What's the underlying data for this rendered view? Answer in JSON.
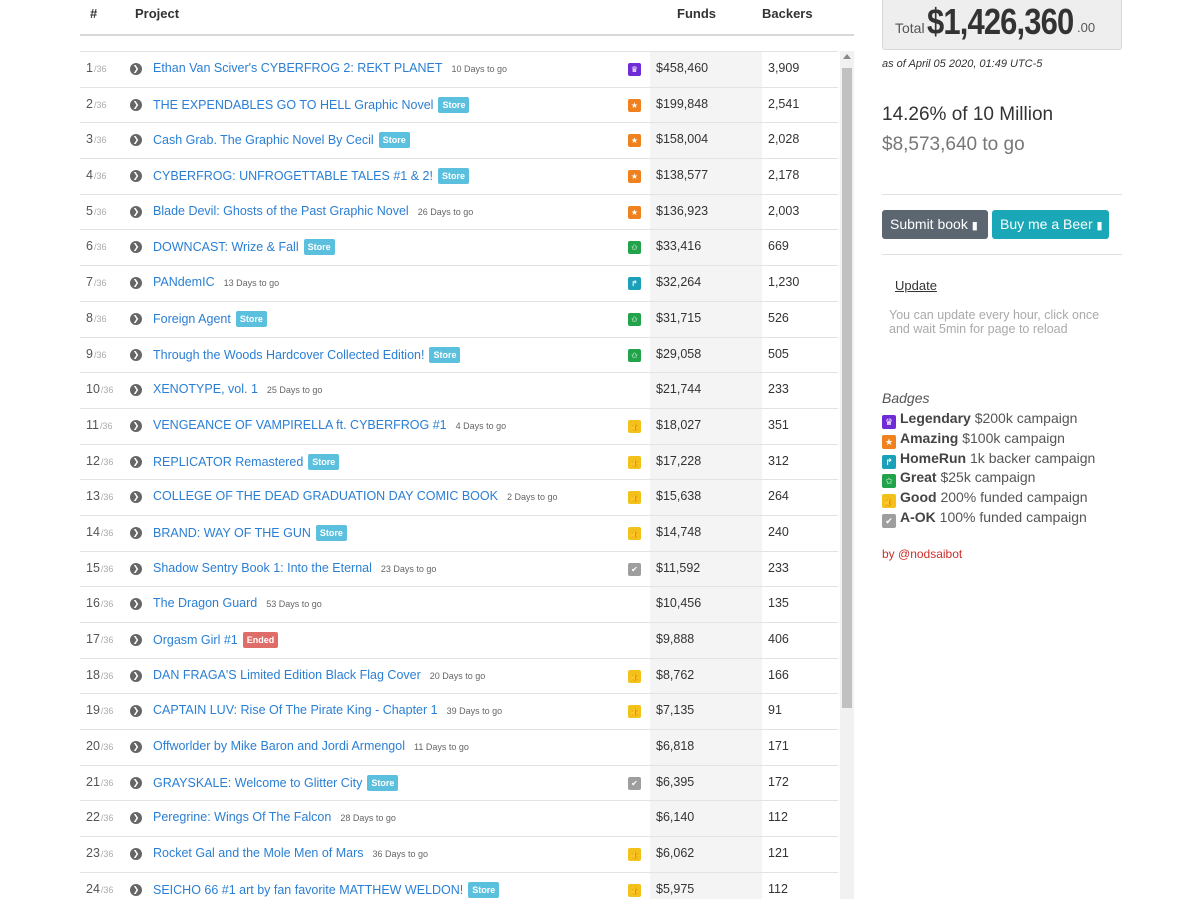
{
  "header": {
    "num": "#",
    "project": "Project",
    "funds": "Funds",
    "backers": "Backers"
  },
  "badge_colors": {
    "legendary": "#6f2bd6",
    "amazing": "#f0811f",
    "homerun": "#1aa0b8",
    "great": "#21a34a",
    "good": "#f2c21b",
    "aok": "#9e9e9e"
  },
  "badge_glyphs": {
    "legendary": "♛",
    "amazing": "★",
    "homerun": "↱",
    "great": "✩",
    "good": "👍",
    "aok": "✔"
  },
  "rows": [
    {
      "rank": "1",
      "of": "/36",
      "title": "Ethan Van Sciver's CYBERFROG 2: REKT PLANET",
      "days": "10 Days to go",
      "store": false,
      "ended": false,
      "badge": "legendary",
      "funds": "$458,460",
      "backers": "3,909"
    },
    {
      "rank": "2",
      "of": "/36",
      "title": "THE EXPENDABLES GO TO HELL Graphic Novel",
      "days": "",
      "store": true,
      "ended": false,
      "badge": "amazing",
      "funds": "$199,848",
      "backers": "2,541"
    },
    {
      "rank": "3",
      "of": "/36",
      "title": "Cash Grab. The Graphic Novel By Cecil",
      "days": "",
      "store": true,
      "ended": false,
      "badge": "amazing",
      "funds": "$158,004",
      "backers": "2,028"
    },
    {
      "rank": "4",
      "of": "/36",
      "title": "CYBERFROG: UNFROGETTABLE TALES #1 & 2!",
      "days": "",
      "store": true,
      "ended": false,
      "badge": "amazing",
      "funds": "$138,577",
      "backers": "2,178"
    },
    {
      "rank": "5",
      "of": "/36",
      "title": "Blade Devil: Ghosts of the Past Graphic Novel",
      "days": "26 Days to go",
      "store": false,
      "ended": false,
      "badge": "amazing",
      "funds": "$136,923",
      "backers": "2,003"
    },
    {
      "rank": "6",
      "of": "/36",
      "title": "DOWNCAST: Wrize & Fall",
      "days": "",
      "store": true,
      "ended": false,
      "badge": "great",
      "funds": "$33,416",
      "backers": "669"
    },
    {
      "rank": "7",
      "of": "/36",
      "title": "PANdemIC",
      "days": "13 Days to go",
      "store": false,
      "ended": false,
      "badge": "homerun",
      "funds": "$32,264",
      "backers": "1,230"
    },
    {
      "rank": "8",
      "of": "/36",
      "title": "Foreign Agent",
      "days": "",
      "store": true,
      "ended": false,
      "badge": "great",
      "funds": "$31,715",
      "backers": "526"
    },
    {
      "rank": "9",
      "of": "/36",
      "title": "Through the Woods Hardcover Collected Edition!",
      "days": "",
      "store": true,
      "ended": false,
      "badge": "great",
      "funds": "$29,058",
      "backers": "505"
    },
    {
      "rank": "10",
      "of": "/36",
      "title": "XENOTYPE, vol. 1",
      "days": "25 Days to go",
      "store": false,
      "ended": false,
      "badge": "",
      "funds": "$21,744",
      "backers": "233"
    },
    {
      "rank": "11",
      "of": "/36",
      "title": "VENGEANCE OF VAMPIRELLA ft. CYBERFROG #1",
      "days": "4 Days to go",
      "store": false,
      "ended": false,
      "badge": "good",
      "funds": "$18,027",
      "backers": "351"
    },
    {
      "rank": "12",
      "of": "/36",
      "title": "REPLICATOR Remastered",
      "days": "",
      "store": true,
      "ended": false,
      "badge": "good",
      "funds": "$17,228",
      "backers": "312"
    },
    {
      "rank": "13",
      "of": "/36",
      "title": "COLLEGE OF THE DEAD GRADUATION DAY COMIC BOOK",
      "days": "2 Days to go",
      "store": false,
      "ended": false,
      "badge": "good",
      "funds": "$15,638",
      "backers": "264"
    },
    {
      "rank": "14",
      "of": "/36",
      "title": "BRAND: WAY OF THE GUN",
      "days": "",
      "store": true,
      "ended": false,
      "badge": "good",
      "funds": "$14,748",
      "backers": "240"
    },
    {
      "rank": "15",
      "of": "/36",
      "title": "Shadow Sentry Book 1: Into the Eternal",
      "days": "23 Days to go",
      "store": false,
      "ended": false,
      "badge": "aok",
      "funds": "$11,592",
      "backers": "233"
    },
    {
      "rank": "16",
      "of": "/36",
      "title": "The Dragon Guard",
      "days": "53 Days to go",
      "store": false,
      "ended": false,
      "badge": "",
      "funds": "$10,456",
      "backers": "135"
    },
    {
      "rank": "17",
      "of": "/36",
      "title": "Orgasm Girl #1",
      "days": "",
      "store": false,
      "ended": true,
      "badge": "",
      "funds": "$9,888",
      "backers": "406"
    },
    {
      "rank": "18",
      "of": "/36",
      "title": "DAN FRAGA'S Limited Edition Black Flag Cover",
      "days": "20 Days to go",
      "store": false,
      "ended": false,
      "badge": "good",
      "funds": "$8,762",
      "backers": "166"
    },
    {
      "rank": "19",
      "of": "/36",
      "title": "CAPTAIN LUV: Rise Of The Pirate King - Chapter 1",
      "days": "39 Days to go",
      "store": false,
      "ended": false,
      "badge": "good",
      "funds": "$7,135",
      "backers": "91"
    },
    {
      "rank": "20",
      "of": "/36",
      "title": "Offworlder by Mike Baron and Jordi Armengol",
      "days": "11 Days to go",
      "store": false,
      "ended": false,
      "badge": "",
      "funds": "$6,818",
      "backers": "171"
    },
    {
      "rank": "21",
      "of": "/36",
      "title": "GRAYSKALE: Welcome to Glitter City",
      "days": "",
      "store": true,
      "ended": false,
      "badge": "aok",
      "funds": "$6,395",
      "backers": "172"
    },
    {
      "rank": "22",
      "of": "/36",
      "title": "Peregrine: Wings Of The Falcon",
      "days": "28 Days to go",
      "store": false,
      "ended": false,
      "badge": "",
      "funds": "$6,140",
      "backers": "112"
    },
    {
      "rank": "23",
      "of": "/36",
      "title": "Rocket Gal and the Mole Men of Mars",
      "days": "36 Days to go",
      "store": false,
      "ended": false,
      "badge": "good",
      "funds": "$6,062",
      "backers": "121"
    },
    {
      "rank": "24",
      "of": "/36",
      "title": "SEICHO 66 #1 art by fan favorite MATTHEW WELDON!",
      "days": "",
      "store": true,
      "ended": false,
      "badge": "good",
      "funds": "$5,975",
      "backers": "112"
    }
  ],
  "labels": {
    "store": "Store",
    "ended": "Ended"
  },
  "total": {
    "label": "Total",
    "amount": "$1,426,360",
    "cents": ".00"
  },
  "as_of": "as of April 05 2020, 01:49 UTC-5",
  "progress": {
    "percent_text": "14.26% of 10 Million",
    "to_go": "$8,573,640 to go"
  },
  "buttons": {
    "submit": "Submit book",
    "beer": "Buy me a Beer"
  },
  "update": {
    "link": "Update",
    "note": "You can update every hour, click once and wait 5min for page to reload"
  },
  "badges_legend": {
    "title": "Badges",
    "items": [
      {
        "key": "legendary",
        "name": "Legendary",
        "desc": "$200k campaign"
      },
      {
        "key": "amazing",
        "name": "Amazing",
        "desc": "$100k campaign"
      },
      {
        "key": "homerun",
        "name": "HomeRun",
        "desc": "1k backer campaign"
      },
      {
        "key": "great",
        "name": "Great",
        "desc": "$25k campaign"
      },
      {
        "key": "good",
        "name": "Good",
        "desc": "200% funded campaign"
      },
      {
        "key": "aok",
        "name": "A-OK",
        "desc": "100% funded campaign"
      }
    ]
  },
  "byline": "by @nodsaibot"
}
